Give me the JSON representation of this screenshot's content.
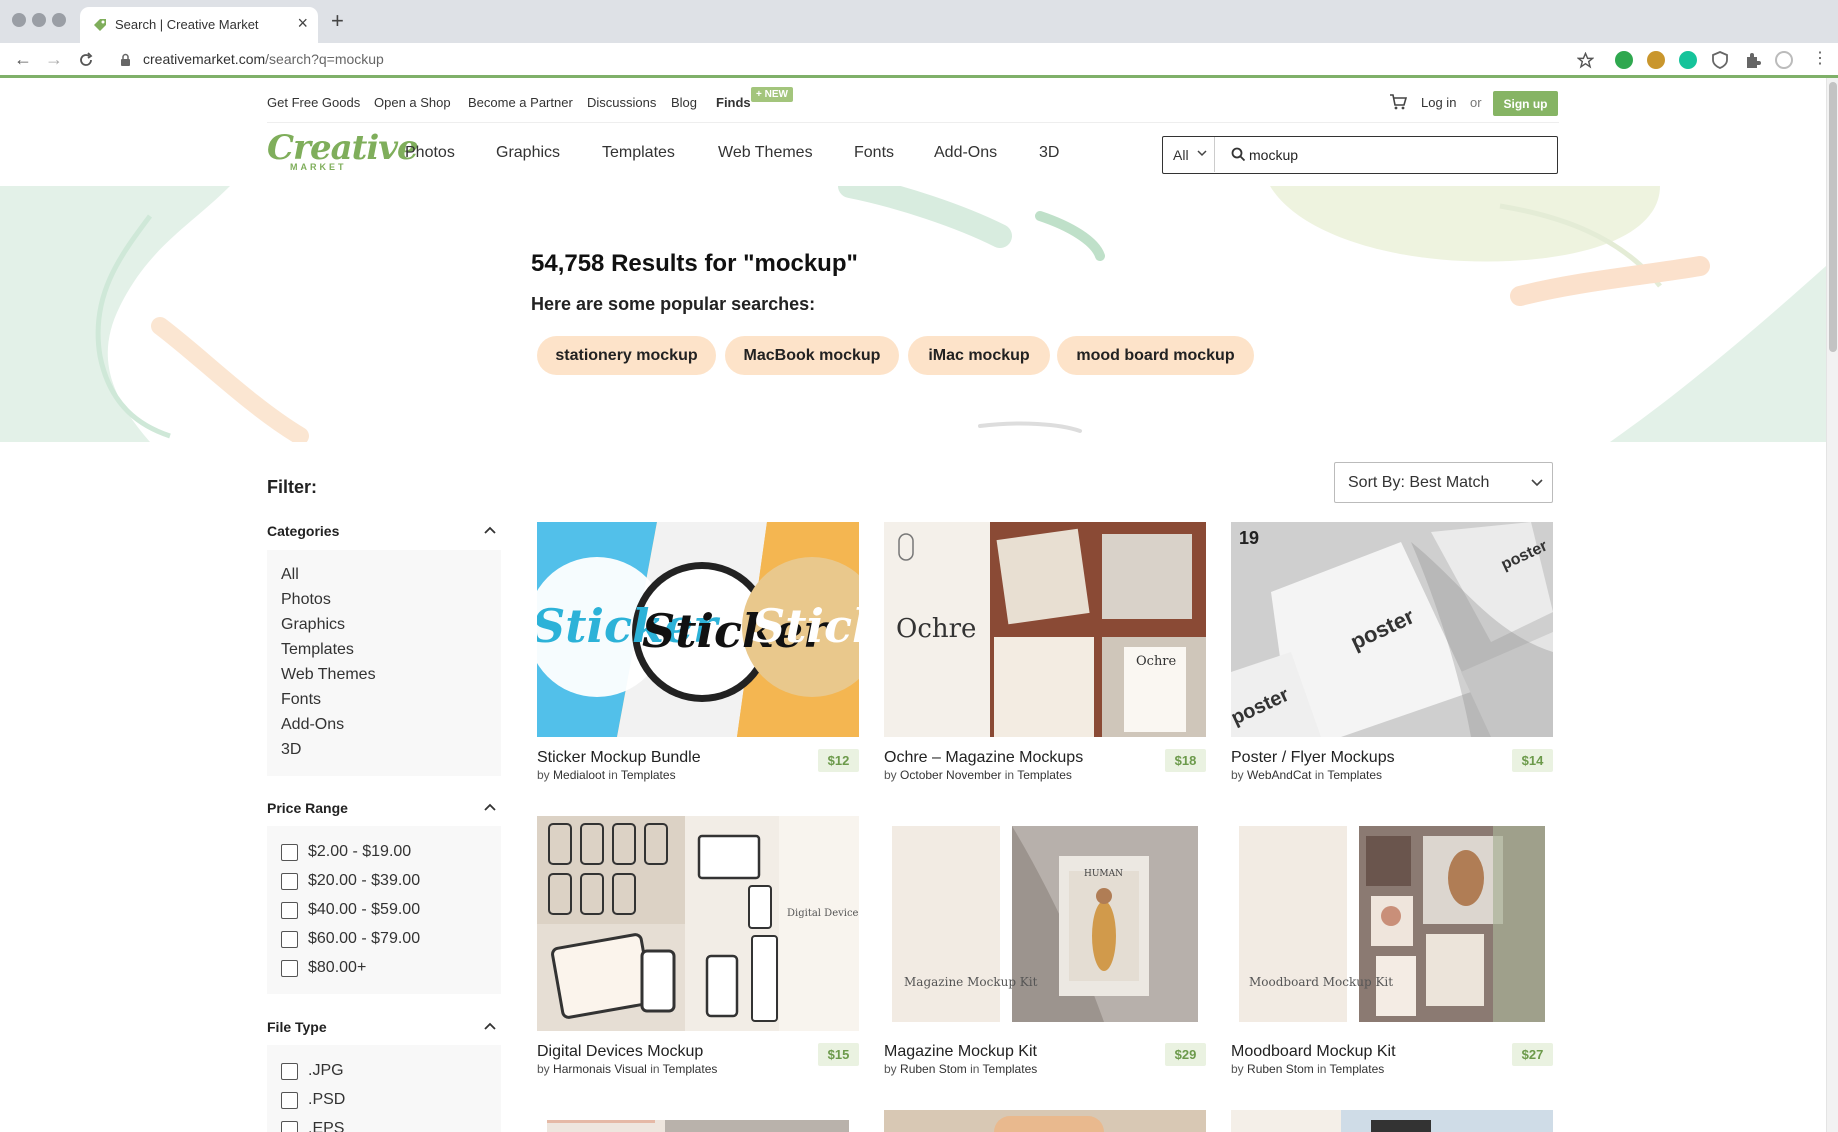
{
  "browser": {
    "tab_title": "Search | Creative Market",
    "url_host": "creativemarket.com",
    "url_path": "/search?q=mockup"
  },
  "topnav": {
    "links": [
      "Get Free Goods",
      "Open a Shop",
      "Become a Partner",
      "Discussions",
      "Blog",
      "Finds"
    ],
    "new_badge": "+ NEW",
    "login": "Log in",
    "or": "or",
    "signup": "Sign up"
  },
  "logo": {
    "word": "Creative",
    "sub": "MARKET"
  },
  "mainnav": [
    "Photos",
    "Graphics",
    "Templates",
    "Web Themes",
    "Fonts",
    "Add-Ons",
    "3D"
  ],
  "search": {
    "category": "All",
    "query": "mockup"
  },
  "hero": {
    "results_title": "54,758 Results for \"mockup\"",
    "popular_label": "Here are some popular searches:",
    "chips": [
      "stationery mockup",
      "MacBook mockup",
      "iMac mockup",
      "mood board mockup"
    ]
  },
  "filter": {
    "title": "Filter:",
    "categories": {
      "title": "Categories",
      "items": [
        "All",
        "Photos",
        "Graphics",
        "Templates",
        "Web Themes",
        "Fonts",
        "Add-Ons",
        "3D"
      ]
    },
    "price": {
      "title": "Price Range",
      "items": [
        "$2.00 - $19.00",
        "$20.00 - $39.00",
        "$40.00 - $59.00",
        "$60.00 - $79.00",
        "$80.00+"
      ]
    },
    "filetype": {
      "title": "File Type",
      "items": [
        ".JPG",
        ".PSD",
        ".EPS"
      ]
    }
  },
  "sort": {
    "label": "Sort By: Best Match"
  },
  "products": [
    {
      "title": "Sticker Mockup Bundle",
      "by": "by",
      "author": "Medialoot",
      "in": "in",
      "category": "Templates",
      "price": "$12"
    },
    {
      "title": "Ochre – Magazine Mockups",
      "by": "by",
      "author": "October November",
      "in": "in",
      "category": "Templates",
      "price": "$18"
    },
    {
      "title": "Poster / Flyer Mockups",
      "by": "by",
      "author": "WebAndCat",
      "in": "in",
      "category": "Templates",
      "price": "$14"
    },
    {
      "title": "Digital Devices Mockup",
      "by": "by",
      "author": "Harmonais Visual",
      "in": "in",
      "category": "Templates",
      "price": "$15"
    },
    {
      "title": "Magazine Mockup Kit",
      "by": "by",
      "author": "Ruben Stom",
      "in": "in",
      "category": "Templates",
      "price": "$29"
    },
    {
      "title": "Moodboard Mockup Kit",
      "by": "by",
      "author": "Ruben Stom",
      "in": "in",
      "category": "Templates",
      "price": "$27"
    }
  ],
  "thumb_text": {
    "sticker": "Sticker",
    "ochre": "Ochre",
    "ochre_small": "Ochre",
    "poster": "poster",
    "nineteen": "19",
    "devices": "Digital Devices Mockup",
    "magazine": "Magazine Mockup Kit",
    "human": "HUMAN",
    "moodboard": "Moodboard Mockup Kit"
  },
  "colors": {
    "brand": "#7fae5b",
    "signup": "#86b464",
    "chip": "#fde3c9",
    "price_bg": "#eaf2e1",
    "price_text": "#6c9a4b"
  }
}
